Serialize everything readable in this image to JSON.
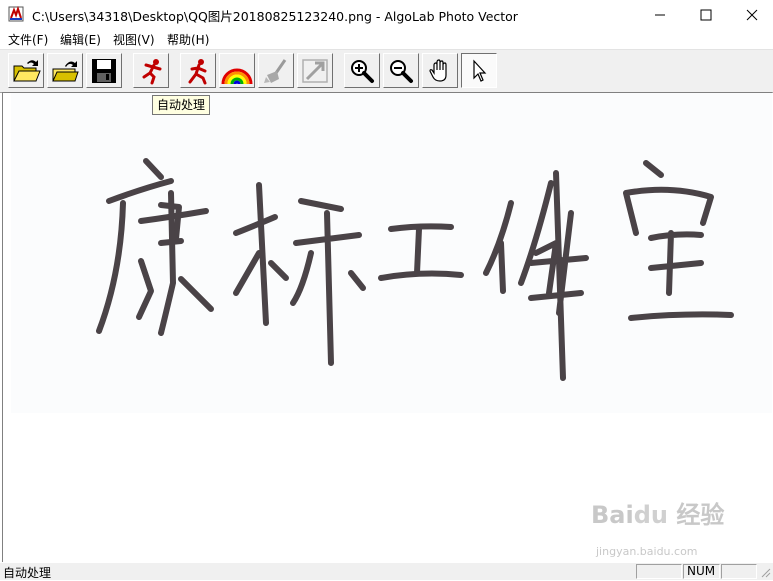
{
  "window": {
    "title": "C:\\Users\\34318\\Desktop\\QQ图片20180825123240.png - AlgoLab Photo Vector",
    "icon": "algolab-app-icon"
  },
  "menubar": {
    "items": [
      "文件(F)",
      "编辑(E)",
      "视图(V)",
      "帮助(H)"
    ]
  },
  "toolbar": {
    "buttons": [
      {
        "name": "open-folder-icon"
      },
      {
        "name": "open-file-icon"
      },
      {
        "name": "save-icon"
      },
      {
        "name": "auto-process-icon"
      },
      {
        "name": "manual-process-icon"
      },
      {
        "name": "color-icon"
      },
      {
        "name": "clean-icon"
      },
      {
        "name": "export-icon"
      },
      {
        "name": "zoom-in-icon"
      },
      {
        "name": "zoom-out-icon"
      },
      {
        "name": "hand-icon"
      },
      {
        "name": "pointer-icon"
      }
    ],
    "tooltip": "自动处理"
  },
  "image": {
    "text": "康桥工作室"
  },
  "watermark": {
    "brand": "Bai du 经验",
    "url": "jingyan.baidu.com"
  },
  "statusbar": {
    "text": "自动处理",
    "num": "NUM"
  },
  "colors": {
    "accent": "#c00000",
    "ink": "#4a4347",
    "chrome": "#f0f0f0"
  }
}
